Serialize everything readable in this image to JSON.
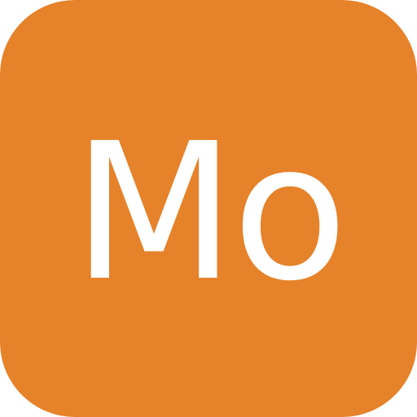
{
  "icon": {
    "text": "Mo",
    "background_color": "#E6822A",
    "text_color": "#FFFFFF"
  }
}
